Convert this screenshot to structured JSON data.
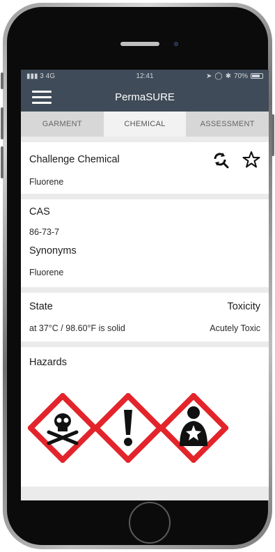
{
  "status_bar": {
    "carrier": "▮▮▮ 3  4G",
    "time": "12:41",
    "battery": "70%"
  },
  "app": {
    "title": "PermaSURE",
    "menu_icon": "hamburger-menu-icon"
  },
  "tabs": [
    {
      "label": "GARMENT",
      "active": false
    },
    {
      "label": "CHEMICAL",
      "active": true
    },
    {
      "label": "ASSESSMENT",
      "active": false
    }
  ],
  "chemical": {
    "heading": "Challenge Chemical",
    "name": "Fluorene",
    "icons": [
      "search-refresh-icon",
      "star-icon"
    ]
  },
  "identifiers": {
    "cas_label": "CAS",
    "cas_value": "86-73-7",
    "synonyms_label": "Synonyms",
    "synonyms_value": "Fluorene"
  },
  "properties": {
    "state_label": "State",
    "state_value": "at 37°C / 98.60°F is solid",
    "toxicity_label": "Toxicity",
    "toxicity_value": "Acutely Toxic"
  },
  "hazards": {
    "label": "Hazards",
    "pictograms": [
      "skull-crossbones-icon",
      "exclamation-mark-icon",
      "health-hazard-icon"
    ]
  },
  "colors": {
    "header_bg": "#3f4b58",
    "hazard_red": "#e3242b"
  }
}
